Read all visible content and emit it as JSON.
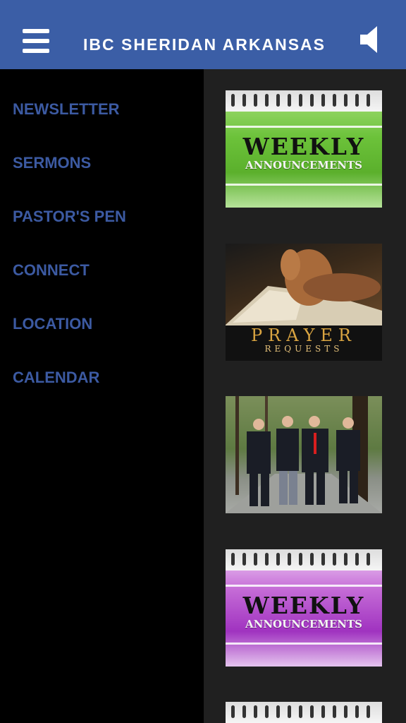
{
  "header": {
    "title": "IBC SHERIDAN ARKANSAS",
    "menu_icon": "hamburger-menu-icon",
    "audio_icon": "speaker-icon",
    "background": "#3b5ea6"
  },
  "sidebar": {
    "items": [
      {
        "label": "NEWSLETTER"
      },
      {
        "label": "SERMONS"
      },
      {
        "label": "PASTOR'S PEN"
      },
      {
        "label": "CONNECT"
      },
      {
        "label": "LOCATION"
      },
      {
        "label": "CALENDAR"
      }
    ],
    "link_color": "#3c5aa2"
  },
  "content": {
    "cards": [
      {
        "image": "weekly-announcements-green",
        "line1": "WEEKLY",
        "line2": "ANNOUNCEMENTS"
      },
      {
        "image": "prayer-requests",
        "line1": "PRAYER",
        "line2": "REQUESTS"
      },
      {
        "image": "group-photo"
      },
      {
        "image": "weekly-announcements-purple",
        "line1": "WEEKLY",
        "line2": "ANNOUNCEMENTS"
      }
    ]
  }
}
